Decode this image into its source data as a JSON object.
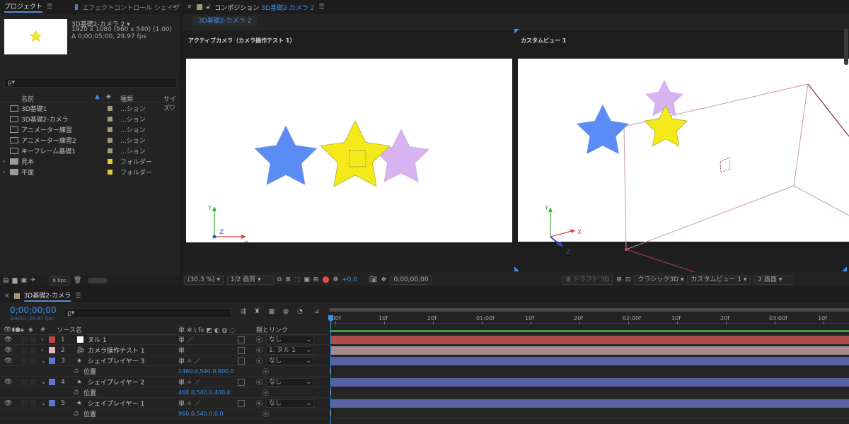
{
  "project": {
    "tab_project": "プロジェクト",
    "tab_effect": "エフェクトコントロール シェイプ",
    "comp_name": "3D基礎2-カメラ 2",
    "comp_dims": "1920 x 1080 (960 x 540) (1.00)",
    "comp_duration": "Δ 0;00;05;00, 29.97 fps",
    "search_placeholder": "ρ̲▾",
    "col_name": "名前",
    "col_type": "種類",
    "col_size": "サイズ",
    "bpc": "8 bpc",
    "items": [
      {
        "name": "3D基礎1",
        "type": "...ション",
        "color": "#a39a76",
        "kind": "comp"
      },
      {
        "name": "3D基礎2-カメラ",
        "type": "...ション",
        "color": "#a39a76",
        "kind": "comp"
      },
      {
        "name": "アニメーター練習",
        "type": "...ション",
        "color": "#a39a76",
        "kind": "comp"
      },
      {
        "name": "アニメーター練習2",
        "type": "...ション",
        "color": "#a39a76",
        "kind": "comp"
      },
      {
        "name": "キーフレーム基礎1",
        "type": "...ション",
        "color": "#a39a76",
        "kind": "comp"
      },
      {
        "name": "見本",
        "type": "フォルダー",
        "color": "#e2cb3a",
        "kind": "folder"
      },
      {
        "name": "平面",
        "type": "フォルダー",
        "color": "#e2cb3a",
        "kind": "folder"
      }
    ]
  },
  "composition": {
    "tab_label": "コンポジション",
    "tab_comp": "3D基礎2-カメラ 2",
    "subtab": "3D基礎2-カメラ 2",
    "view_left_title": "アクティブカメラ（カメラ操作テスト 1）",
    "view_right_title": "カスタムビュー 1",
    "zoom": "(30.3 %)",
    "resolution": "1/2 画質",
    "exposure": "+0.0",
    "timecode": "0;00;00;00",
    "draft3d": "ドラフト 3D",
    "renderer": "クラシック3D",
    "view_select": "カスタムビュー 1",
    "layout_select": "2 画面",
    "axis_x": "X",
    "axis_y": "Y",
    "axis_z": "Z"
  },
  "timeline": {
    "tab": "3D基礎2-カメラ",
    "current_time": "0;00;00;00",
    "frame_info": "00000 (29.97 fps)",
    "col_source": "ソース名",
    "col_parent": "親とリンク",
    "col_switches": "単 ✲ \\ fx ◩ ◐ ◍ ◌",
    "ruler": [
      ":00f",
      "10f",
      "20f",
      "01:00f",
      "10f",
      "20f",
      "02:00f",
      "10f",
      "20f",
      "03:00f",
      "10f"
    ],
    "layers": [
      {
        "num": "1",
        "name": "ヌル 1",
        "label": "#c04545",
        "kind": "null",
        "parent": "なし",
        "bar": "#b24b4b",
        "switches": "単  ／"
      },
      {
        "num": "2",
        "name": "カメラ操作テスト 1",
        "label": "#e2b6c2",
        "kind": "camera",
        "parent": "1. ヌル 1",
        "bar": "#a18b8e",
        "switches": "単"
      },
      {
        "num": "3",
        "name": "シェイプレイヤー 3",
        "label": "#5d75d4",
        "kind": "shape",
        "parent": "なし",
        "bar": "#5863a5",
        "switches": "単 ✧ ／",
        "prop": "位置",
        "value": "1460.0,540.0,800.0"
      },
      {
        "num": "4",
        "name": "シェイプレイヤー 2",
        "label": "#5d75d4",
        "kind": "shape",
        "parent": "なし",
        "bar": "#5863a5",
        "switches": "単 ✧ ／",
        "prop": "位置",
        "value": "460.0,540.0,400.0"
      },
      {
        "num": "5",
        "name": "シェイプレイヤー 1",
        "label": "#5d75d4",
        "kind": "shape",
        "parent": "なし",
        "bar": "#5863a5",
        "switches": "単 ✧ ／",
        "prop": "位置",
        "value": "960.0,540.0,0.0"
      }
    ]
  },
  "colors": {
    "accent": "#3d90e8",
    "star_blue": "#5b8bf4",
    "star_yellow": "#f4ea1a",
    "star_lilac": "#d7b4f1"
  }
}
